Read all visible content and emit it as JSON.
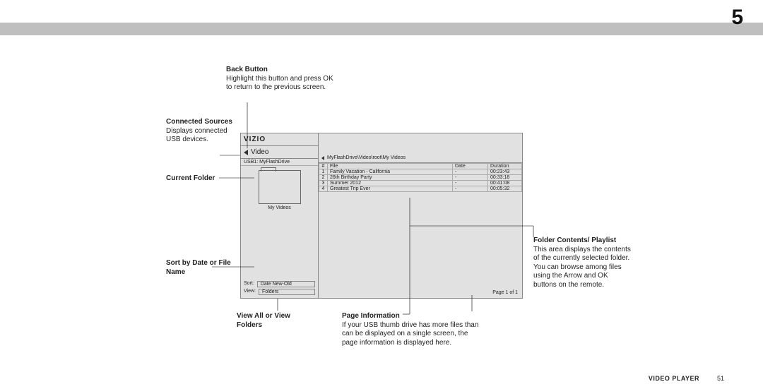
{
  "chapter_number": "5",
  "footer": {
    "label": "VIDEO PLAYER",
    "page": "51"
  },
  "screen": {
    "logo": "VIZIO",
    "title": "Video",
    "usb_source": "USB1: MyFlashDrive",
    "current_folder_label": "My Videos",
    "sort": {
      "label": "Sort:",
      "value": "Date New-Old"
    },
    "view": {
      "label": "View:",
      "value": "Folders"
    },
    "breadcrumb": "MyFlashDrive\\Video\\root\\My Videos",
    "columns": {
      "num": "#",
      "file": "File",
      "date": "Date",
      "duration": "Duration"
    },
    "rows": [
      {
        "num": "1",
        "file": "Family Vacation - California",
        "date": "-",
        "duration": "00:23:43"
      },
      {
        "num": "2",
        "file": "26th Birthday Party",
        "date": "-",
        "duration": "00:33:18"
      },
      {
        "num": "3",
        "file": "Summer 2012",
        "date": "-",
        "duration": "00:41:08"
      },
      {
        "num": "4",
        "file": "Greatest Trip Ever",
        "date": "-",
        "duration": "00:05:32"
      }
    ],
    "page_info": "Page 1 of 1"
  },
  "callouts": {
    "back": {
      "title": "Back Button",
      "body": "Highlight this button and press OK to return to the previous screen."
    },
    "sources": {
      "title": "Connected Sources",
      "body": "Displays connected USB devices."
    },
    "folder": {
      "title": "Current Folder"
    },
    "sort": {
      "title": "Sort by Date or File Name"
    },
    "view": {
      "title": "View All or View Folders"
    },
    "page": {
      "title": "Page Information",
      "body": "If your USB thumb drive has more files than can be displayed on a single screen, the page information is displayed here."
    },
    "contents": {
      "title": "Folder Contents/ Playlist",
      "body": "This area displays the contents of the currently selected folder. You can browse among files using the Arrow and OK buttons on the remote."
    }
  }
}
